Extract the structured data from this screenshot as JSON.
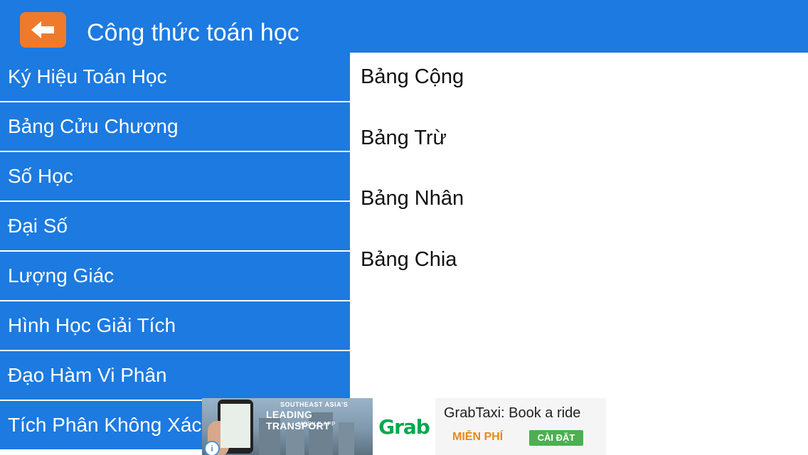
{
  "appbar": {
    "title": "Công thức toán học",
    "back_icon": "arrow-left-icon"
  },
  "sidebar": {
    "items": [
      {
        "label": "Ký Hiệu Toán Học"
      },
      {
        "label": "Bảng Cửu Chương"
      },
      {
        "label": "Số Học"
      },
      {
        "label": "Đại Số"
      },
      {
        "label": "Lượng Giác"
      },
      {
        "label": "Hình Học Giải Tích"
      },
      {
        "label": "Đạo Hàm Vi Phân"
      },
      {
        "label": "Tích Phân Không Xác"
      }
    ]
  },
  "content": {
    "items": [
      {
        "label": "Bảng Cộng"
      },
      {
        "label": "Bảng Trừ"
      },
      {
        "label": "Bảng Nhân"
      },
      {
        "label": "Bảng Chia"
      }
    ]
  },
  "ad": {
    "banner_small": "SOUTHEAST ASIA'S",
    "banner_big": "LEADING TRANSPORT",
    "banner_sub": "MOBILE APP",
    "brand": "Grab",
    "title": "GrabTaxi: Book a ride",
    "free_label": "MIỄN PHÍ",
    "install_label": "CÀI ĐẶT",
    "info_icon": "info-icon"
  },
  "colors": {
    "primary": "#1c7ae0",
    "back_button": "#f07a2c",
    "grab_green": "#00a94f",
    "install_green": "#4caf50",
    "free_orange": "#e88a1a"
  }
}
